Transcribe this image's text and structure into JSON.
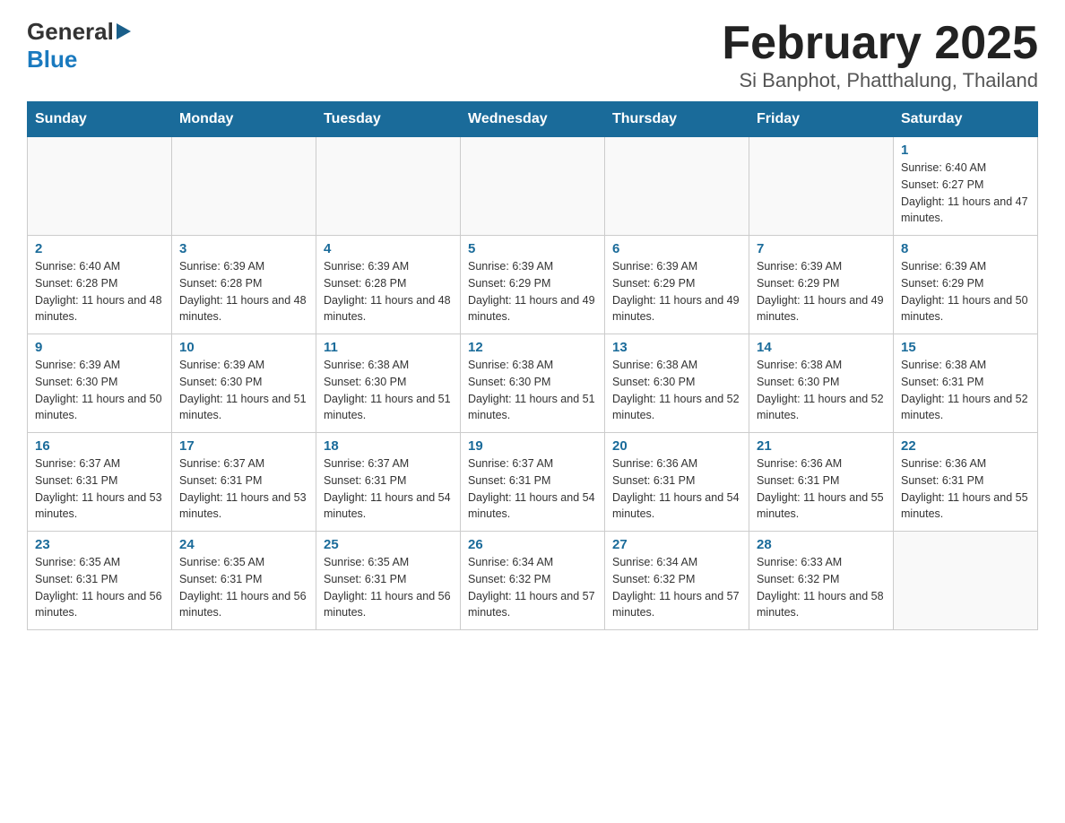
{
  "header": {
    "logo_general": "General",
    "logo_blue": "Blue",
    "title": "February 2025",
    "subtitle": "Si Banphot, Phatthalung, Thailand"
  },
  "weekdays": [
    "Sunday",
    "Monday",
    "Tuesday",
    "Wednesday",
    "Thursday",
    "Friday",
    "Saturday"
  ],
  "weeks": [
    [
      {
        "day": "",
        "sunrise": "",
        "sunset": "",
        "daylight": ""
      },
      {
        "day": "",
        "sunrise": "",
        "sunset": "",
        "daylight": ""
      },
      {
        "day": "",
        "sunrise": "",
        "sunset": "",
        "daylight": ""
      },
      {
        "day": "",
        "sunrise": "",
        "sunset": "",
        "daylight": ""
      },
      {
        "day": "",
        "sunrise": "",
        "sunset": "",
        "daylight": ""
      },
      {
        "day": "",
        "sunrise": "",
        "sunset": "",
        "daylight": ""
      },
      {
        "day": "1",
        "sunrise": "Sunrise: 6:40 AM",
        "sunset": "Sunset: 6:27 PM",
        "daylight": "Daylight: 11 hours and 47 minutes."
      }
    ],
    [
      {
        "day": "2",
        "sunrise": "Sunrise: 6:40 AM",
        "sunset": "Sunset: 6:28 PM",
        "daylight": "Daylight: 11 hours and 48 minutes."
      },
      {
        "day": "3",
        "sunrise": "Sunrise: 6:39 AM",
        "sunset": "Sunset: 6:28 PM",
        "daylight": "Daylight: 11 hours and 48 minutes."
      },
      {
        "day": "4",
        "sunrise": "Sunrise: 6:39 AM",
        "sunset": "Sunset: 6:28 PM",
        "daylight": "Daylight: 11 hours and 48 minutes."
      },
      {
        "day": "5",
        "sunrise": "Sunrise: 6:39 AM",
        "sunset": "Sunset: 6:29 PM",
        "daylight": "Daylight: 11 hours and 49 minutes."
      },
      {
        "day": "6",
        "sunrise": "Sunrise: 6:39 AM",
        "sunset": "Sunset: 6:29 PM",
        "daylight": "Daylight: 11 hours and 49 minutes."
      },
      {
        "day": "7",
        "sunrise": "Sunrise: 6:39 AM",
        "sunset": "Sunset: 6:29 PM",
        "daylight": "Daylight: 11 hours and 49 minutes."
      },
      {
        "day": "8",
        "sunrise": "Sunrise: 6:39 AM",
        "sunset": "Sunset: 6:29 PM",
        "daylight": "Daylight: 11 hours and 50 minutes."
      }
    ],
    [
      {
        "day": "9",
        "sunrise": "Sunrise: 6:39 AM",
        "sunset": "Sunset: 6:30 PM",
        "daylight": "Daylight: 11 hours and 50 minutes."
      },
      {
        "day": "10",
        "sunrise": "Sunrise: 6:39 AM",
        "sunset": "Sunset: 6:30 PM",
        "daylight": "Daylight: 11 hours and 51 minutes."
      },
      {
        "day": "11",
        "sunrise": "Sunrise: 6:38 AM",
        "sunset": "Sunset: 6:30 PM",
        "daylight": "Daylight: 11 hours and 51 minutes."
      },
      {
        "day": "12",
        "sunrise": "Sunrise: 6:38 AM",
        "sunset": "Sunset: 6:30 PM",
        "daylight": "Daylight: 11 hours and 51 minutes."
      },
      {
        "day": "13",
        "sunrise": "Sunrise: 6:38 AM",
        "sunset": "Sunset: 6:30 PM",
        "daylight": "Daylight: 11 hours and 52 minutes."
      },
      {
        "day": "14",
        "sunrise": "Sunrise: 6:38 AM",
        "sunset": "Sunset: 6:30 PM",
        "daylight": "Daylight: 11 hours and 52 minutes."
      },
      {
        "day": "15",
        "sunrise": "Sunrise: 6:38 AM",
        "sunset": "Sunset: 6:31 PM",
        "daylight": "Daylight: 11 hours and 52 minutes."
      }
    ],
    [
      {
        "day": "16",
        "sunrise": "Sunrise: 6:37 AM",
        "sunset": "Sunset: 6:31 PM",
        "daylight": "Daylight: 11 hours and 53 minutes."
      },
      {
        "day": "17",
        "sunrise": "Sunrise: 6:37 AM",
        "sunset": "Sunset: 6:31 PM",
        "daylight": "Daylight: 11 hours and 53 minutes."
      },
      {
        "day": "18",
        "sunrise": "Sunrise: 6:37 AM",
        "sunset": "Sunset: 6:31 PM",
        "daylight": "Daylight: 11 hours and 54 minutes."
      },
      {
        "day": "19",
        "sunrise": "Sunrise: 6:37 AM",
        "sunset": "Sunset: 6:31 PM",
        "daylight": "Daylight: 11 hours and 54 minutes."
      },
      {
        "day": "20",
        "sunrise": "Sunrise: 6:36 AM",
        "sunset": "Sunset: 6:31 PM",
        "daylight": "Daylight: 11 hours and 54 minutes."
      },
      {
        "day": "21",
        "sunrise": "Sunrise: 6:36 AM",
        "sunset": "Sunset: 6:31 PM",
        "daylight": "Daylight: 11 hours and 55 minutes."
      },
      {
        "day": "22",
        "sunrise": "Sunrise: 6:36 AM",
        "sunset": "Sunset: 6:31 PM",
        "daylight": "Daylight: 11 hours and 55 minutes."
      }
    ],
    [
      {
        "day": "23",
        "sunrise": "Sunrise: 6:35 AM",
        "sunset": "Sunset: 6:31 PM",
        "daylight": "Daylight: 11 hours and 56 minutes."
      },
      {
        "day": "24",
        "sunrise": "Sunrise: 6:35 AM",
        "sunset": "Sunset: 6:31 PM",
        "daylight": "Daylight: 11 hours and 56 minutes."
      },
      {
        "day": "25",
        "sunrise": "Sunrise: 6:35 AM",
        "sunset": "Sunset: 6:31 PM",
        "daylight": "Daylight: 11 hours and 56 minutes."
      },
      {
        "day": "26",
        "sunrise": "Sunrise: 6:34 AM",
        "sunset": "Sunset: 6:32 PM",
        "daylight": "Daylight: 11 hours and 57 minutes."
      },
      {
        "day": "27",
        "sunrise": "Sunrise: 6:34 AM",
        "sunset": "Sunset: 6:32 PM",
        "daylight": "Daylight: 11 hours and 57 minutes."
      },
      {
        "day": "28",
        "sunrise": "Sunrise: 6:33 AM",
        "sunset": "Sunset: 6:32 PM",
        "daylight": "Daylight: 11 hours and 58 minutes."
      },
      {
        "day": "",
        "sunrise": "",
        "sunset": "",
        "daylight": ""
      }
    ]
  ]
}
